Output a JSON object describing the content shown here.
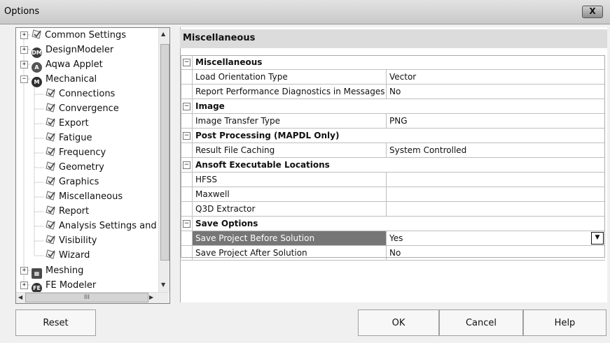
{
  "window": {
    "title": "Options",
    "close_label": "X"
  },
  "tree": {
    "items": [
      {
        "label": "Common Settings",
        "icon": "check-icon",
        "level": 1,
        "expander": "+"
      },
      {
        "label": "DesignModeler",
        "icon": "dm-icon",
        "level": 1,
        "expander": "+"
      },
      {
        "label": "Aqwa Applet",
        "icon": "aqwa-icon",
        "level": 1,
        "expander": "+"
      },
      {
        "label": "Mechanical",
        "icon": "mechanical-icon",
        "level": 1,
        "expander": "-"
      },
      {
        "label": "Connections",
        "icon": "check-icon",
        "level": 2
      },
      {
        "label": "Convergence",
        "icon": "check-icon",
        "level": 2
      },
      {
        "label": "Export",
        "icon": "check-icon",
        "level": 2
      },
      {
        "label": "Fatigue",
        "icon": "check-icon",
        "level": 2
      },
      {
        "label": "Frequency",
        "icon": "check-icon",
        "level": 2
      },
      {
        "label": "Geometry",
        "icon": "check-icon",
        "level": 2
      },
      {
        "label": "Graphics",
        "icon": "check-icon",
        "level": 2
      },
      {
        "label": "Miscellaneous",
        "icon": "check-icon",
        "level": 2,
        "selected": true
      },
      {
        "label": "Report",
        "icon": "check-icon",
        "level": 2
      },
      {
        "label": "Analysis Settings and",
        "icon": "check-icon",
        "level": 2
      },
      {
        "label": "Visibility",
        "icon": "check-icon",
        "level": 2
      },
      {
        "label": "Wizard",
        "icon": "check-icon",
        "level": 2
      },
      {
        "label": "Meshing",
        "icon": "meshing-icon",
        "level": 1,
        "expander": "+"
      },
      {
        "label": "FE Modeler",
        "icon": "fe-icon",
        "level": 1,
        "expander": "+"
      }
    ],
    "scroll_grip": "III"
  },
  "panel": {
    "header": "Miscellaneous",
    "categories": [
      {
        "title": "Miscellaneous",
        "rows": [
          {
            "name": "Load Orientation Type",
            "value": "Vector"
          },
          {
            "name": "Report Performance Diagnostics in Messages",
            "value": "No"
          }
        ]
      },
      {
        "title": "Image",
        "rows": [
          {
            "name": "Image Transfer Type",
            "value": "PNG"
          }
        ]
      },
      {
        "title": "Post Processing (MAPDL Only)",
        "rows": [
          {
            "name": "Result File Caching",
            "value": "System Controlled"
          }
        ]
      },
      {
        "title": "Ansoft Executable Locations",
        "rows": [
          {
            "name": "HFSS",
            "value": ""
          },
          {
            "name": "Maxwell",
            "value": ""
          },
          {
            "name": "Q3D Extractor",
            "value": ""
          }
        ]
      },
      {
        "title": "Save Options",
        "rows": [
          {
            "name": "Save Project Before Solution",
            "value": "Yes",
            "selected": true
          },
          {
            "name": "Save Project After Solution",
            "value": "No"
          }
        ]
      }
    ]
  },
  "buttons": {
    "reset": "Reset",
    "ok": "OK",
    "cancel": "Cancel",
    "help": "Help"
  }
}
